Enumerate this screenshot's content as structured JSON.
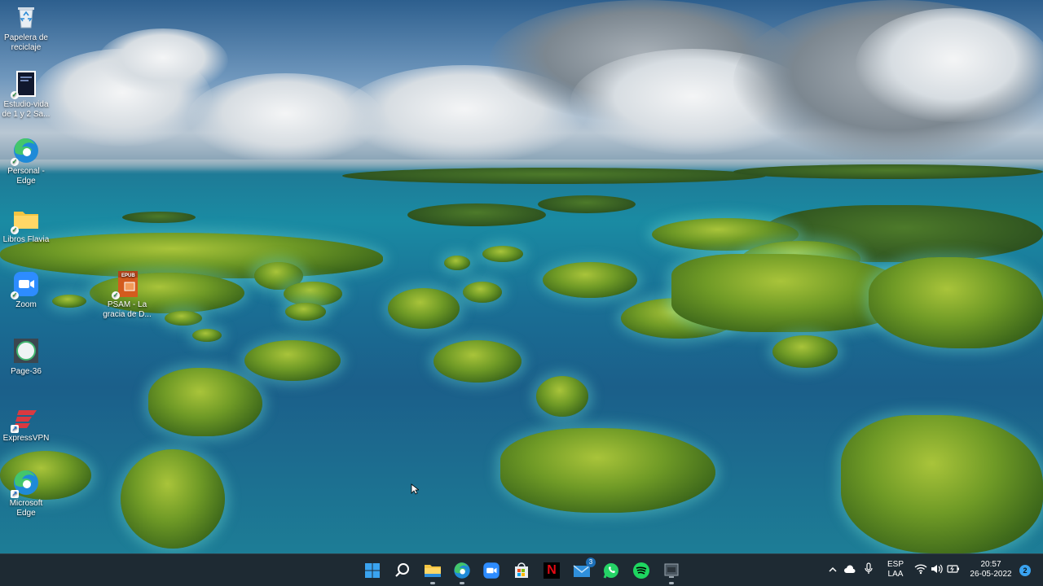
{
  "desktop": {
    "icons": [
      {
        "label": "Papelera de\nreciclaje",
        "icon": "recycle-bin-icon"
      },
      {
        "label": "Estudio-vida\nde 1 y 2 Sa...",
        "icon": "document-icon"
      },
      {
        "label": "Personal -\nEdge",
        "icon": "edge-icon"
      },
      {
        "label": "Libros Flavia",
        "icon": "folder-icon"
      },
      {
        "label": "Zoom",
        "icon": "zoom-icon"
      },
      {
        "label": "PSAM - La\ngracia de D...",
        "icon": "epub-icon",
        "tag": "EPUB"
      },
      {
        "label": "Page-36",
        "icon": "page-icon"
      },
      {
        "label": "ExpressVPN",
        "icon": "expressvpn-icon"
      },
      {
        "label": "Microsoft\nEdge",
        "icon": "edge-icon"
      }
    ]
  },
  "taskbar": {
    "apps": [
      {
        "name": "start-button",
        "icon": "windows-icon"
      },
      {
        "name": "search-button",
        "icon": "search-icon"
      },
      {
        "name": "file-explorer",
        "icon": "folder-icon"
      },
      {
        "name": "edge",
        "icon": "edge-icon"
      },
      {
        "name": "zoom",
        "icon": "zoom-icon"
      },
      {
        "name": "store",
        "icon": "store-icon"
      },
      {
        "name": "netflix",
        "icon": "netflix-icon",
        "text": "N"
      },
      {
        "name": "mail",
        "icon": "mail-icon",
        "badge": "3"
      },
      {
        "name": "whatsapp",
        "icon": "whatsapp-icon"
      },
      {
        "name": "spotify",
        "icon": "spotify-icon"
      },
      {
        "name": "app",
        "icon": "app-icon"
      }
    ],
    "tray": {
      "language_top": "ESP",
      "language_bottom": "LAA",
      "time": "20:57",
      "date": "26-05-2022",
      "notifications": "2"
    }
  },
  "colors": {
    "taskbar_bg": "#1e2a33",
    "accent": "#0a84ff"
  }
}
